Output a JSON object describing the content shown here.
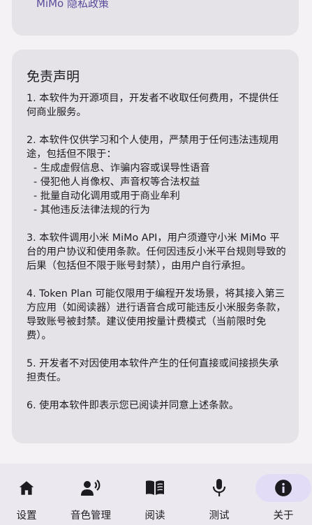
{
  "top_card": {
    "privacy_link": "MiMo 隐私政策"
  },
  "disclaimer": {
    "title": "免责声明",
    "p1": "1. 本软件为开源项目，开发者不收取任何费用，不提供任何商业服务。",
    "p2_intro": "2. 本软件仅供学习和个人使用，严禁用于任何违法违规用途，包括但不限于：",
    "p2_items": [
      "- 生成虚假信息、诈骗内容或误导性语音",
      "- 侵犯他人肖像权、声音权等合法权益",
      "- 批量自动化调用或用于商业牟利",
      "- 其他违反法律法规的行为"
    ],
    "p3": "3. 本软件调用小米 MiMo API，用户须遵守小米 MiMo 平台的用户协议和使用条款。任何因违反小米平台规则导致的后果（包括但不限于账号封禁），由用户自行承担。",
    "p4": "4. Token Plan 可能仅限用于编程开发场景，将其接入第三方应用（如阅读器）进行语音合成可能违反小米服务条款，导致账号被封禁。建议使用按量计费模式（当前限时免费）。",
    "p5": "5. 开发者不对因使用本软件产生的任何直接或间接损失承担责任。",
    "p6": "6. 使用本软件即表示您已阅读并同意上述条款。"
  },
  "nav": {
    "items": [
      {
        "label": "设置",
        "icon": "home-icon"
      },
      {
        "label": "音色管理",
        "icon": "voice-person-icon"
      },
      {
        "label": "阅读",
        "icon": "book-icon"
      },
      {
        "label": "测试",
        "icon": "mic-icon"
      },
      {
        "label": "关于",
        "icon": "info-icon"
      }
    ],
    "active_index": 4,
    "active_color": "#e3dcf7"
  }
}
